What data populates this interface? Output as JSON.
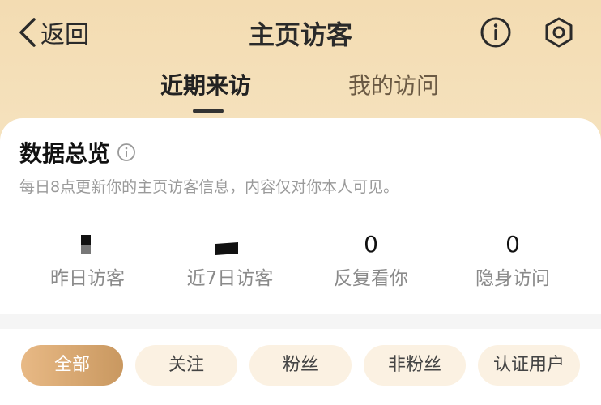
{
  "header": {
    "back_label": "返回",
    "title": "主页访客",
    "icons": [
      "info-icon",
      "gear-icon"
    ]
  },
  "tabs": [
    {
      "label": "近期来访",
      "active": true
    },
    {
      "label": "我的访问",
      "active": false
    }
  ],
  "overview": {
    "title": "数据总览",
    "subtitle": "每日8点更新你的主页访客信息，内容仅对你本人可见。",
    "stats": [
      {
        "value": "",
        "label": "昨日访客"
      },
      {
        "value": "",
        "label": "近7日访客"
      },
      {
        "value": "0",
        "label": "反复看你"
      },
      {
        "value": "0",
        "label": "隐身访问"
      }
    ]
  },
  "filters": [
    {
      "label": "全部",
      "active": true
    },
    {
      "label": "关注",
      "active": false
    },
    {
      "label": "粉丝",
      "active": false
    },
    {
      "label": "非粉丝",
      "active": false
    },
    {
      "label": "认证用户",
      "active": false
    }
  ],
  "colors": {
    "header_gradient_top": "#f3dcb2",
    "active_chip_start": "#e8b985",
    "active_chip_end": "#c99860",
    "chip_bg": "#fbf1e2"
  }
}
